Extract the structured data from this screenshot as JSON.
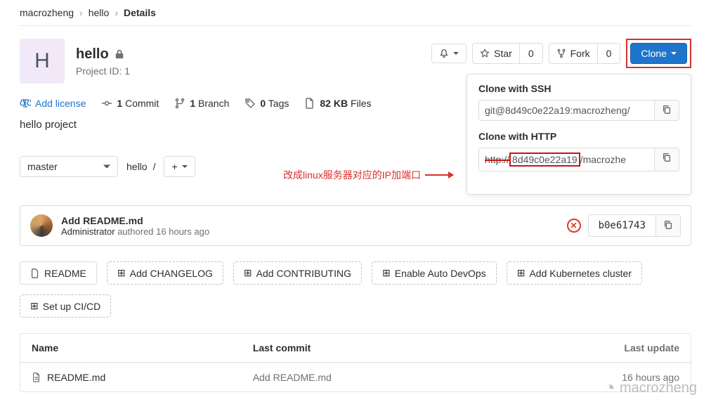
{
  "breadcrumb": {
    "owner": "macrozheng",
    "project": "hello",
    "current": "Details"
  },
  "project": {
    "avatar_letter": "H",
    "name": "hello",
    "id_label": "Project ID: 1"
  },
  "actions": {
    "star_label": "Star",
    "star_count": "0",
    "fork_label": "Fork",
    "fork_count": "0",
    "clone_label": "Clone"
  },
  "clone": {
    "ssh_title": "Clone with SSH",
    "ssh_value": "git@8d49c0e22a19:macrozheng/",
    "http_title": "Clone with HTTP",
    "http_prefix": "http://",
    "http_host": "8d49c0e22a19",
    "http_suffix": "/macrozhe"
  },
  "annotation": "改成linux服务器对应的IP加端口",
  "stats": {
    "license": "Add license",
    "commits_count": "1",
    "commits_label": "Commit",
    "branches_count": "1",
    "branches_label": "Branch",
    "tags_count": "0",
    "tags_label": "Tags",
    "size": "82 KB",
    "size_label": "Files"
  },
  "description": "hello project",
  "branch": {
    "selected": "master",
    "path": "hello",
    "sep": "/"
  },
  "last_commit": {
    "message": "Add README.md",
    "author": "Administrator",
    "verb": "authored",
    "time": "16 hours ago",
    "sha": "b0e61743"
  },
  "chips": {
    "readme": "README",
    "changelog": "Add CHANGELOG",
    "contributing": "Add CONTRIBUTING",
    "auto_devops": "Enable Auto DevOps",
    "k8s": "Add Kubernetes cluster",
    "cicd": "Set up CI/CD"
  },
  "table": {
    "h_name": "Name",
    "h_commit": "Last commit",
    "h_update": "Last update",
    "rows": [
      {
        "name": "README.md",
        "commit": "Add README.md",
        "update": "16 hours ago"
      }
    ]
  },
  "watermark": "macrozheng"
}
